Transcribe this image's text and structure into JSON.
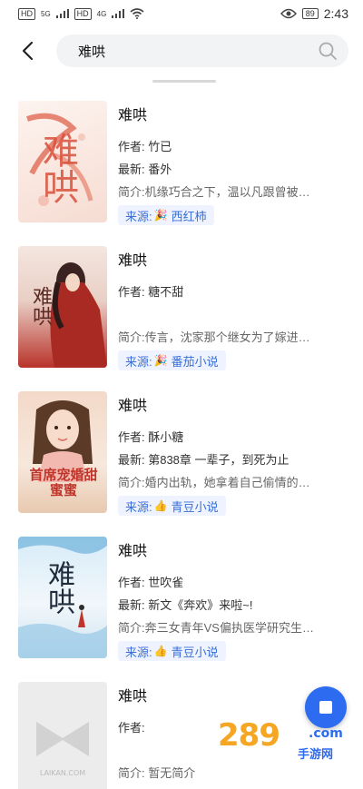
{
  "status_bar": {
    "left_chips": [
      "HD",
      "HD"
    ],
    "signal_labels": [
      "5G",
      "4G"
    ],
    "battery": "89",
    "time": "2:43"
  },
  "search": {
    "query": "难哄",
    "back_icon": "back-arrow-icon",
    "search_icon": "search-icon"
  },
  "books": [
    {
      "title": "难哄",
      "author": "作者: 竹已",
      "latest": "最新: 番外",
      "desc": "简介:机缘巧合之下，温以凡跟曾被…",
      "source_prefix": "来源:",
      "source_icon": "🎉",
      "source": "西红柿",
      "cover_text": "难哄"
    },
    {
      "title": "难哄",
      "author": "作者: 糖不甜",
      "latest": "",
      "desc": "简介:传言，沈家那个继女为了嫁进…",
      "source_prefix": "来源:",
      "source_icon": "🎉",
      "source": "番茄小说",
      "cover_text": "难哄"
    },
    {
      "title": "难哄",
      "author": "作者: 酥小糖",
      "latest": "最新: 第838章 一辈子，到死为止",
      "desc": "简介:婚内出轨，她拿着自己偷情的…",
      "source_prefix": "来源:",
      "source_icon": "👍",
      "source": "青豆小说",
      "cover_text": "首席宠婚甜蜜蜜"
    },
    {
      "title": "难哄",
      "author": "作者: 世吹雀",
      "latest": "最新: 新文《奔欢》来啦~!",
      "desc": "简介:奔三女青年VS偏执医学研究生…",
      "source_prefix": "来源:",
      "source_icon": "👍",
      "source": "青豆小说",
      "cover_text": "难哄"
    },
    {
      "title": "难哄",
      "author": "作者:",
      "latest": "",
      "desc": "简介: 暂无简介",
      "cover_text": "LAIKAN.COM"
    }
  ],
  "watermark": {
    "num": "289",
    "com": ".com",
    "sub": "手游网"
  },
  "colors": {
    "accent": "#2d6cf0",
    "tag_bg": "#eef3ff",
    "tag_text": "#3a6fd8"
  }
}
